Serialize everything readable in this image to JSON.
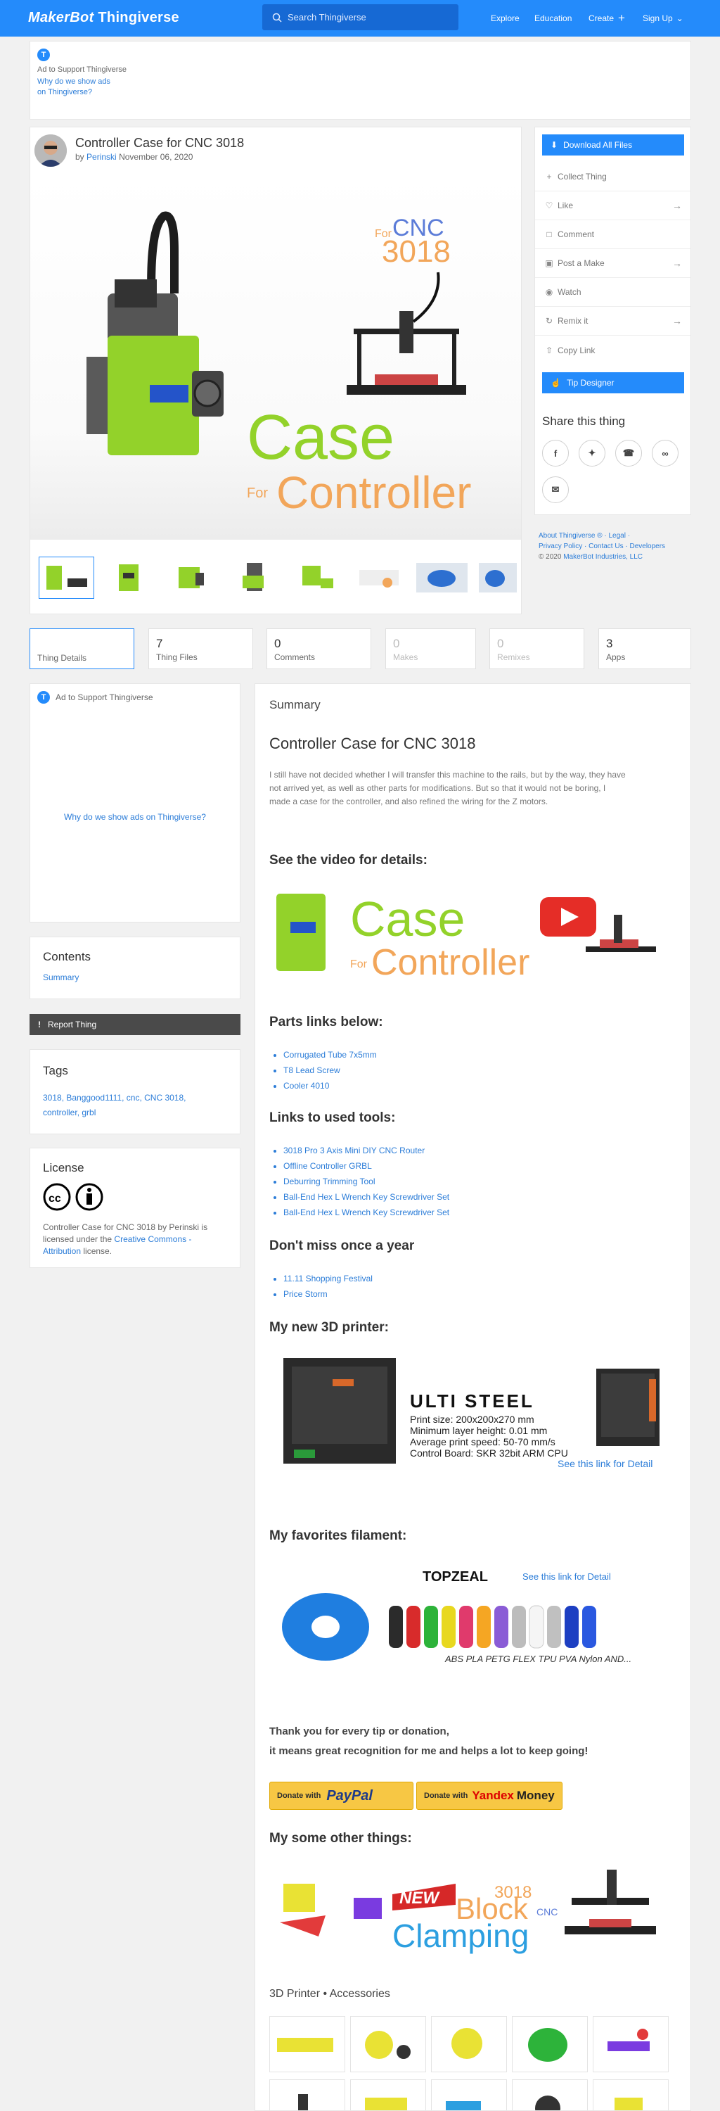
{
  "header": {
    "logo_a": "MakerBot",
    "logo_b": "Thingiverse",
    "search_placeholder": "Search Thingiverse",
    "nav": [
      "Explore",
      "Education",
      "Create",
      "Sign Up"
    ]
  },
  "ad_top": {
    "label": "Ad to Support Thingiverse",
    "link1": "Why do we show ads",
    "link2": "on Thingiverse?"
  },
  "thing": {
    "title": "Controller Case for CNC 3018",
    "by": "by",
    "author": "Perinski",
    "date": "November 06, 2020"
  },
  "hero": {
    "t1": "For",
    "t2": "CNC",
    "t3": "3018",
    "t4": "Case",
    "t5": "For",
    "t6": "Controller"
  },
  "actions": {
    "download": "Download All Files",
    "collect": "Collect Thing",
    "like": "Like",
    "comment": "Comment",
    "post": "Post a Make",
    "watch": "Watch",
    "remix": "Remix it",
    "copy": "Copy Link",
    "tip": "Tip Designer",
    "share_title": "Share this thing"
  },
  "sidefoot": {
    "l1": "About Thingiverse ® · Legal ·",
    "l2": "Privacy Policy · Contact Us · Developers",
    "l3": "© 2020",
    "l3b": "MakerBot Industries, LLC"
  },
  "tabs": {
    "details": "Thing Details",
    "files_n": "7",
    "files": "Thing Files",
    "comments_n": "0",
    "comments": "Comments",
    "makes_n": "0",
    "makes": "Makes",
    "remixes_n": "0",
    "remixes": "Remixes",
    "apps_n": "3",
    "apps": "Apps"
  },
  "left_ad": {
    "label": "Ad to Support Thingiverse",
    "link": "Why do we show ads on Thingiverse?"
  },
  "contents": {
    "title": "Contents",
    "item": "Summary"
  },
  "report": "Report Thing",
  "tags": {
    "title": "Tags",
    "line1": "3018, Banggood1111, cnc, CNC 3018,",
    "line2": "controller, grbl"
  },
  "license": {
    "title": "License",
    "t1": "Controller Case for CNC 3018 by Perinski is",
    "t2": "licensed under the",
    "link": "Creative Commons -",
    "link2": "Attribution",
    "t3": "license."
  },
  "summary": {
    "label": "Summary",
    "title": "Controller Case for CNC 3018",
    "p1": "I still have not decided whether I will transfer this machine to the rails, but by the way, they have",
    "p2": "not arrived yet, as well as other parts for modifications. But so that it would not be boring, I",
    "p3": "made a case for the controller, and also refined the wiring for the Z motors.",
    "video_h": "See the video for details:",
    "parts_h": "Parts links below:",
    "parts": [
      "Corrugated Tube 7x5mm",
      "T8 Lead Screw",
      "Cooler 4010"
    ],
    "tools_h": "Links to used tools:",
    "tools": [
      "3018 Pro 3 Axis Mini DIY CNC Router",
      "Offline Controller GRBL",
      "Deburring Trimming Tool",
      "Ball-End Hex L Wrench Key Screwdriver Set",
      "Ball-End Hex L Wrench Key Screwdriver Set"
    ],
    "miss_h": "Don't miss once a year",
    "miss": [
      "11.11 Shopping Festival",
      "Price Storm"
    ],
    "printer_h": "My new 3D printer:",
    "printer": {
      "name": "ULTI STEEL",
      "s1": "Print size: 200x200x270 mm",
      "s2": "Minimum layer height: 0.01 mm",
      "s3": "Average print speed: 50-70 mm/s",
      "s4": "Control Board: SKR 32bit ARM CPU",
      "link": "See this link for Detail"
    },
    "fil_h": "My favorites filament:",
    "fil": {
      "brand": "TOPZEAL",
      "link": "See this link for Detail",
      "types": "ABS PLA PETG FLEX TPU PVA Nylon AND..."
    },
    "thanks1": "Thank you for every tip or donation,",
    "thanks2": "it means great recognition for me and helps a lot to keep going!",
    "donate1a": "Donate with",
    "donate1b": "PayPal",
    "donate2a": "Donate with",
    "donate2b": "Yandex",
    "donate2c": "Money",
    "other_h": "My some other things:",
    "other": {
      "a": "NEW",
      "b": "Block",
      "c": "3018",
      "d": "CNC",
      "e": "Clamping"
    },
    "acc_h": "3D Printer • Accessories"
  },
  "colors": {
    "accent": "#248bfb",
    "link": "#2c7dd8",
    "lime": "#93d22a",
    "orange": "#f2a65a"
  }
}
